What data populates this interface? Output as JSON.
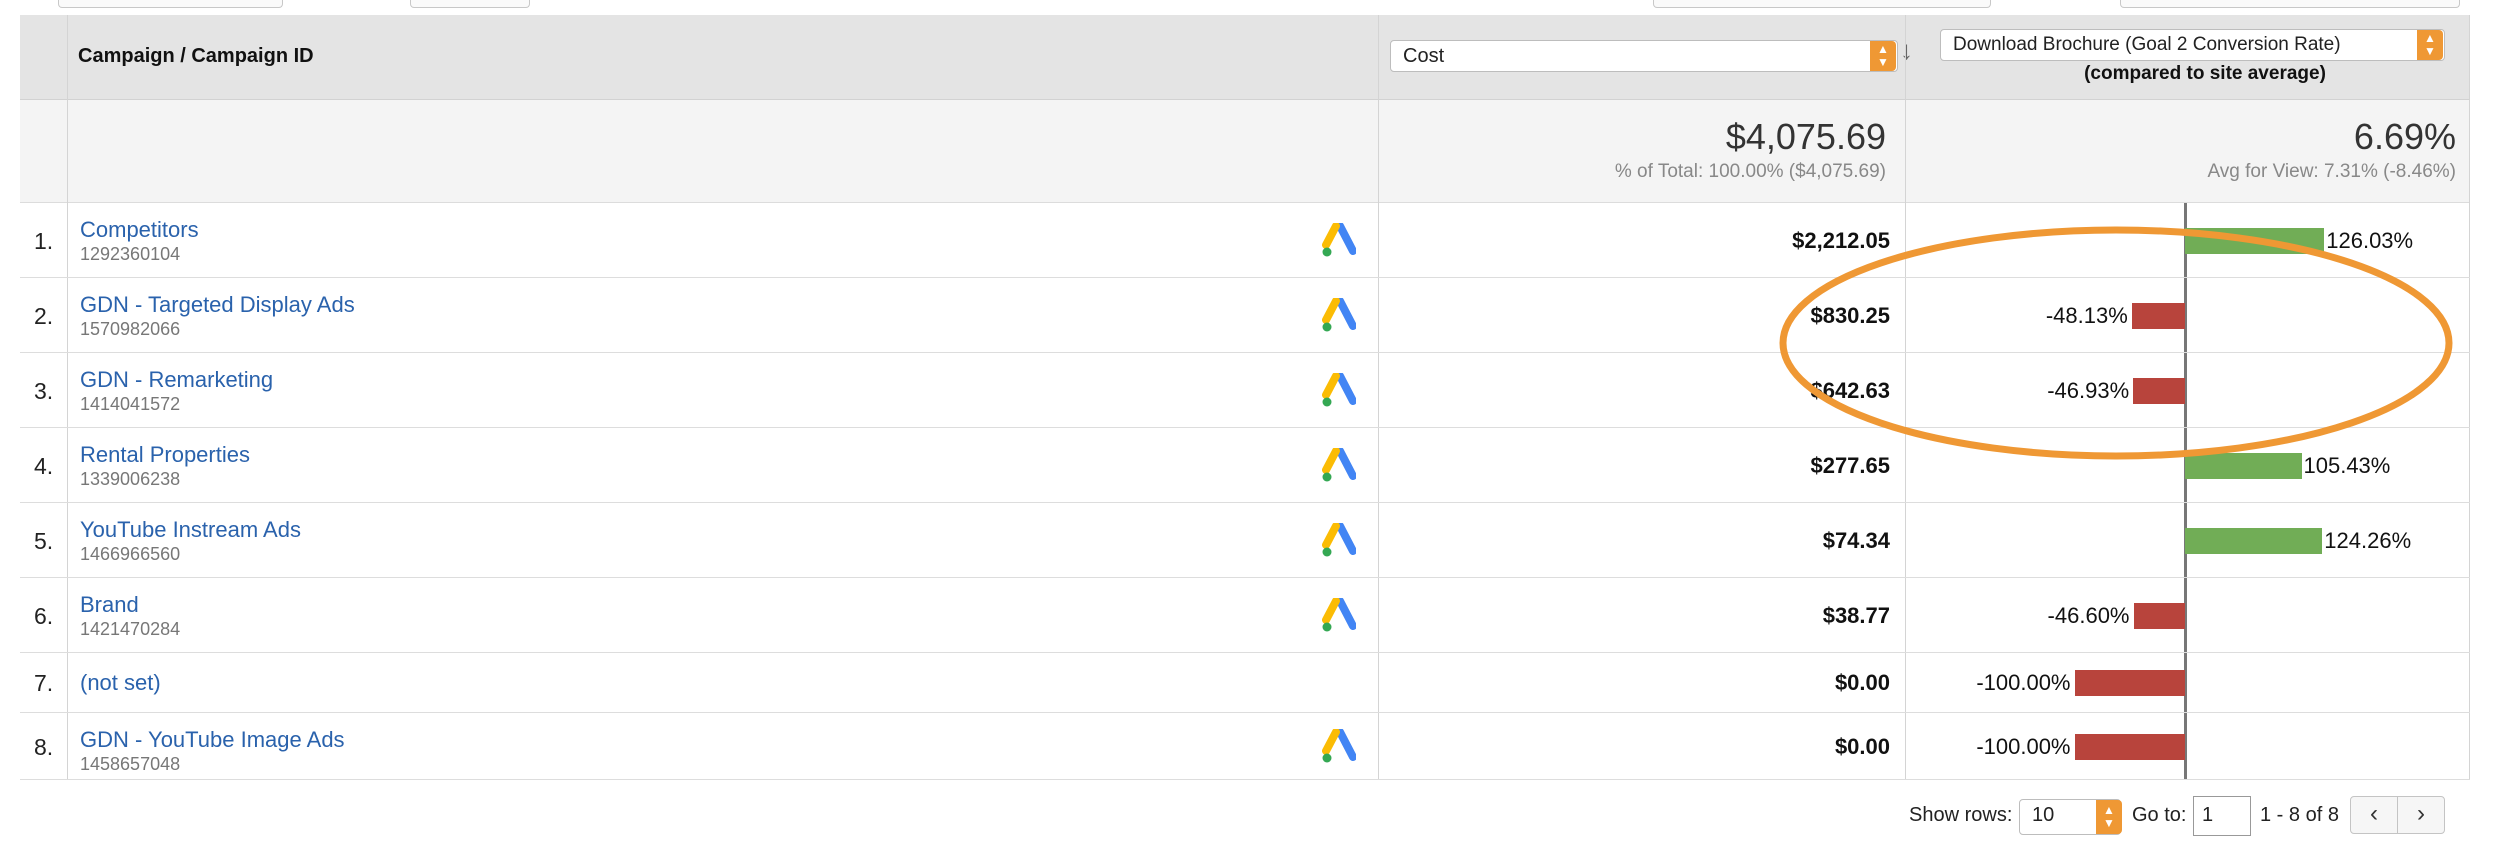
{
  "header": {
    "campaign_col": "Campaign / Campaign ID",
    "metric1_selected": "Cost",
    "metric2_selected": "Download Brochure (Goal 2 Conversion Rate)",
    "metric2_sub": "(compared to site average)"
  },
  "summary": {
    "cost_total": "$4,075.69",
    "cost_pct": "% of Total: 100.00% ($4,075.69)",
    "rate_total": "6.69%",
    "rate_avg": "Avg for View: 7.31% (-8.46%)"
  },
  "rows": [
    {
      "num": "1.",
      "name": "Competitors",
      "id": "1292360104",
      "cost": "$2,212.05",
      "compare": "126.03%",
      "compare_value": 126.03,
      "ads_icon": true
    },
    {
      "num": "2.",
      "name": "GDN - Targeted Display Ads",
      "id": "1570982066",
      "cost": "$830.25",
      "compare": "-48.13%",
      "compare_value": -48.13,
      "ads_icon": true
    },
    {
      "num": "3.",
      "name": "GDN - Remarketing",
      "id": "1414041572",
      "cost": "$642.63",
      "compare": "-46.93%",
      "compare_value": -46.93,
      "ads_icon": true
    },
    {
      "num": "4.",
      "name": "Rental Properties",
      "id": "1339006238",
      "cost": "$277.65",
      "compare": "105.43%",
      "compare_value": 105.43,
      "ads_icon": true
    },
    {
      "num": "5.",
      "name": "YouTube Instream Ads",
      "id": "1466966560",
      "cost": "$74.34",
      "compare": "124.26%",
      "compare_value": 124.26,
      "ads_icon": true
    },
    {
      "num": "6.",
      "name": "Brand",
      "id": "1421470284",
      "cost": "$38.77",
      "compare": "-46.60%",
      "compare_value": -46.6,
      "ads_icon": true
    },
    {
      "num": "7.",
      "name": "(not set)",
      "id": "",
      "cost": "$0.00",
      "compare": "-100.00%",
      "compare_value": -100.0,
      "ads_icon": false
    },
    {
      "num": "8.",
      "name": "GDN - YouTube Image Ads",
      "id": "1458657048",
      "cost": "$0.00",
      "compare": "-100.00%",
      "compare_value": -100.0,
      "ads_icon": true
    }
  ],
  "footer": {
    "show_rows_label": "Show rows:",
    "show_rows_value": "10",
    "goto_label": "Go to:",
    "goto_value": "1",
    "range": "1 - 8 of 8"
  },
  "colors": {
    "positive_bar": "#71ad56",
    "negative_bar": "#b8443c",
    "link": "#2a62ac",
    "annotation": "#ef9834"
  },
  "icons": {
    "ads": "google-ads-icon",
    "sort": "sort-down-arrow-icon",
    "prev": "chevron-left-icon",
    "next": "chevron-right-icon"
  }
}
